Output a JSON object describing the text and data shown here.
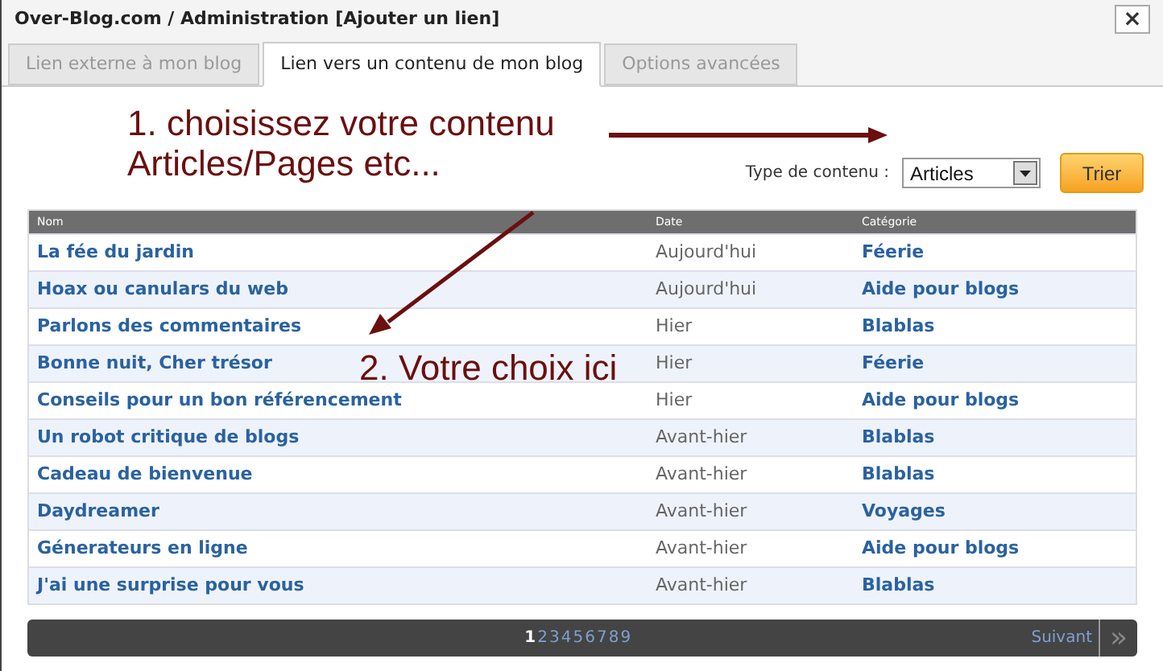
{
  "window": {
    "title": "Over-Blog.com / Administration [Ajouter un lien]",
    "close": "×"
  },
  "tabs": [
    {
      "label": "Lien externe à mon blog",
      "selected": false
    },
    {
      "label": "Lien vers un contenu de mon blog",
      "selected": true
    },
    {
      "label": "Options avancées",
      "selected": false
    }
  ],
  "annotations": [
    "1. choisissez votre contenu\nArticles/Pages etc...",
    "2. Votre choix ici"
  ],
  "filter": {
    "label": "Type de contenu :",
    "value": "Articles",
    "button": "Trier"
  },
  "table": {
    "columns": [
      "Nom",
      "Date",
      "Catégorie"
    ],
    "rows": [
      {
        "name": "La fée du jardin",
        "date": "Aujourd'hui",
        "category": "Féerie"
      },
      {
        "name": "Hoax ou canulars du web",
        "date": "Aujourd'hui",
        "category": "Aide pour blogs"
      },
      {
        "name": "Parlons des commentaires",
        "date": "Hier",
        "category": "Blablas"
      },
      {
        "name": "Bonne nuit, Cher trésor",
        "date": "Hier",
        "category": "Féerie"
      },
      {
        "name": "Conseils pour un bon référencement",
        "date": "Hier",
        "category": "Aide pour blogs"
      },
      {
        "name": "Un robot critique de blogs",
        "date": "Avant-hier",
        "category": "Blablas"
      },
      {
        "name": "Cadeau de bienvenue",
        "date": "Avant-hier",
        "category": "Blablas"
      },
      {
        "name": "Daydreamer",
        "date": "Avant-hier",
        "category": "Voyages"
      },
      {
        "name": "Génerateurs en ligne",
        "date": "Avant-hier",
        "category": "Aide pour blogs"
      },
      {
        "name": "J'ai une surprise pour vous",
        "date": "Avant-hier",
        "category": "Blablas"
      }
    ]
  },
  "pagination": {
    "pages": [
      {
        "label": "1",
        "selected": true
      },
      {
        "label": "2",
        "selected": false
      },
      {
        "label": "3",
        "selected": false
      },
      {
        "label": "4",
        "selected": false
      },
      {
        "label": "5",
        "selected": false
      },
      {
        "label": "6",
        "selected": false
      },
      {
        "label": "7",
        "selected": false
      },
      {
        "label": "8",
        "selected": false
      },
      {
        "label": "9",
        "selected": false
      }
    ],
    "next": "Suivant",
    "last": "»"
  }
}
